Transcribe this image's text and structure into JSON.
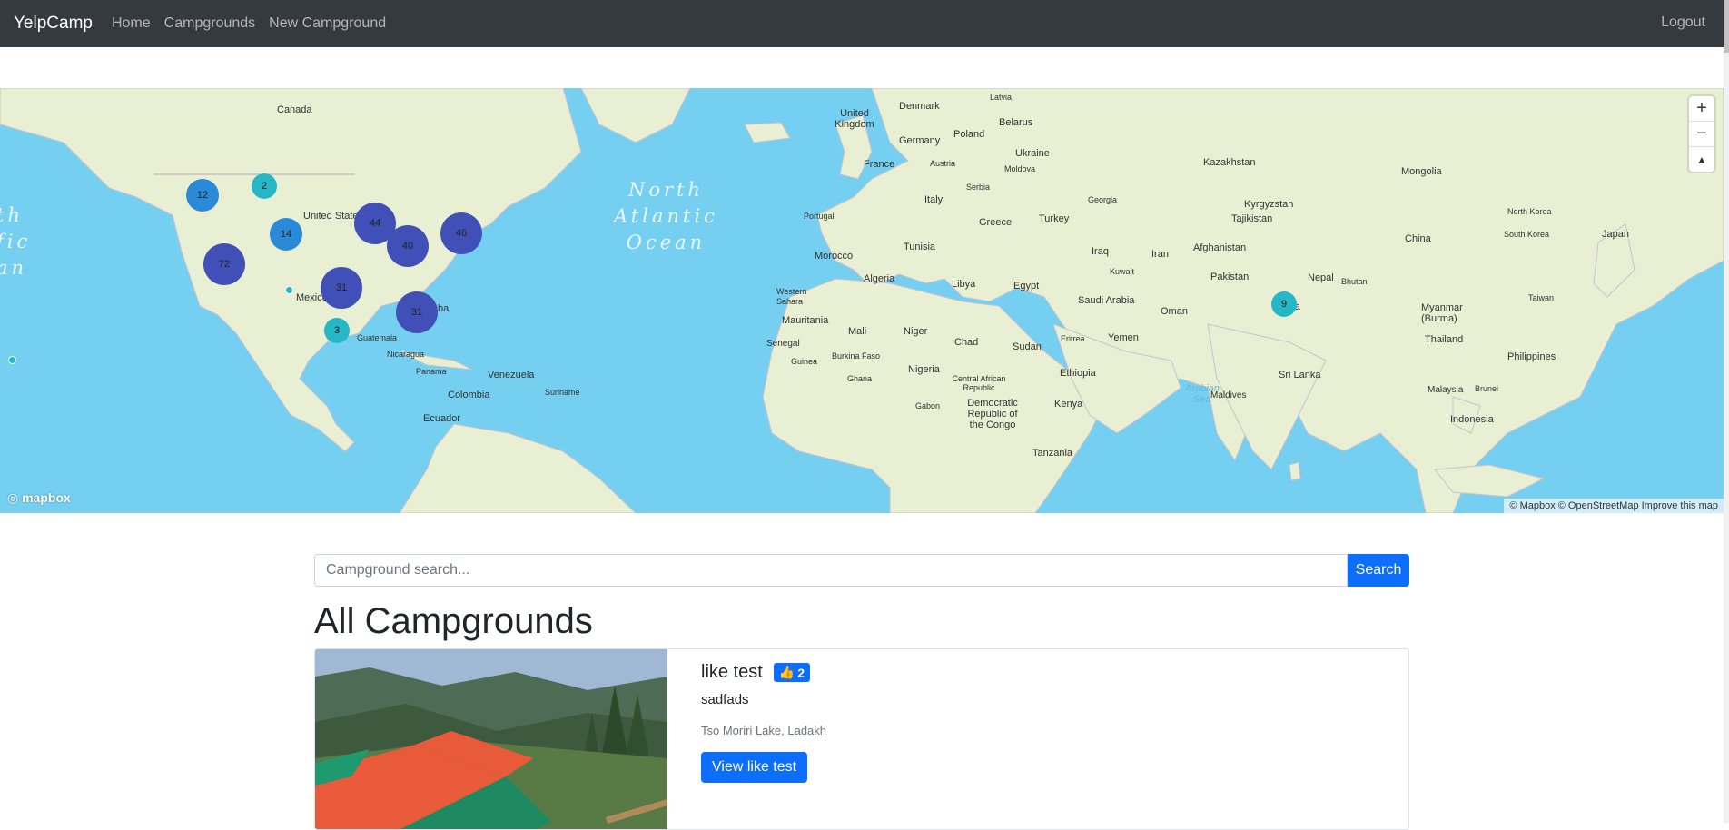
{
  "navbar": {
    "brand": "YelpCamp",
    "links": [
      "Home",
      "Campgrounds",
      "New Campground"
    ],
    "logout": "Logout"
  },
  "map": {
    "ocean_labels": [
      "North\nAtlantic\nOcean",
      "th\nfic\nan"
    ],
    "sea_labels": [
      "Arabian\nSea"
    ],
    "country_labels": [
      "Canada",
      "United States",
      "Mexico",
      "Cuba",
      "Guatemala",
      "Nicaragua",
      "Panama",
      "Venezuela",
      "Colombia",
      "Suriname",
      "Ecuador",
      "Denmark",
      "Latvia",
      "United Kingdom",
      "Germany",
      "Poland",
      "Belarus",
      "France",
      "Austria",
      "Ukraine",
      "Moldova",
      "Serbia",
      "Italy",
      "Portugal",
      "Georgia",
      "Greece",
      "Turkey",
      "Kazakhstan",
      "Mongolia",
      "Kyrgyzstan",
      "Tajikistan",
      "North Korea",
      "South Korea",
      "Japan",
      "China",
      "Iraq",
      "Iran",
      "Kuwait",
      "Afghanistan",
      "Pakistan",
      "Nepal",
      "Bhutan",
      "India",
      "Saudi Arabia",
      "Oman",
      "Yemen",
      "Eritrea",
      "Taiwan",
      "Myanmar (Burma)",
      "Thailand",
      "Philippines",
      "Sri Lanka",
      "Maldives",
      "Malaysia",
      "Brunei",
      "Indonesia",
      "Morocco",
      "Tunisia",
      "Algeria",
      "Libya",
      "Egypt",
      "Western Sahara",
      "Mauritania",
      "Mali",
      "Niger",
      "Chad",
      "Sudan",
      "Senegal",
      "Guinea",
      "Burkina Faso",
      "Ghana",
      "Nigeria",
      "Central African Republic",
      "Ethiopia",
      "Gabon",
      "Democratic Republic of the Congo",
      "Kenya",
      "Tanzania"
    ],
    "clusters": [
      {
        "count": "12",
        "size": "mid"
      },
      {
        "count": "2",
        "size": "small"
      },
      {
        "count": "14",
        "size": "mid"
      },
      {
        "count": "44",
        "size": "big"
      },
      {
        "count": "40",
        "size": "big"
      },
      {
        "count": "46",
        "size": "big"
      },
      {
        "count": "72",
        "size": "big"
      },
      {
        "count": "31",
        "size": "big"
      },
      {
        "count": "31",
        "size": "big"
      },
      {
        "count": "3",
        "size": "small"
      },
      {
        "count": "9",
        "size": "small"
      }
    ],
    "controls": {
      "zoom_in": "+",
      "zoom_out": "−",
      "compass": "▲"
    },
    "logo": "mapbox",
    "attribution": "© Mapbox © OpenStreetMap Improve this map"
  },
  "search": {
    "placeholder": "Campground search...",
    "button": "Search"
  },
  "page_title": "All Campgrounds",
  "campgrounds": [
    {
      "title": "like test",
      "likes": "2",
      "description": "sadfads",
      "location": "Tso Moriri Lake, Ladakh",
      "view_button": "View like test"
    }
  ],
  "colors": {
    "navbar": "#343a40",
    "primary": "#0d6efd",
    "ocean": "#75cff0",
    "land": "#e8efd0"
  }
}
